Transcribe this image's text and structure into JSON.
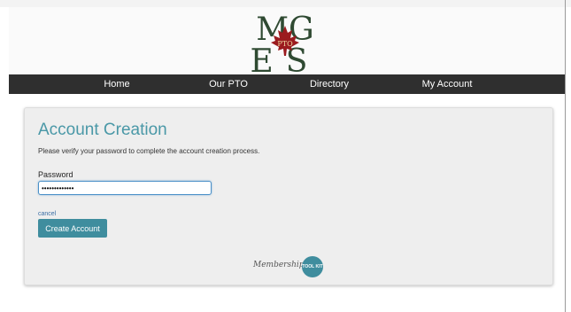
{
  "header": {
    "logo": {
      "top_letters": "MG",
      "bottom_letters": "ES",
      "emblem_text": "PTO",
      "colors": {
        "letters": "#2f4a32",
        "leaf": "#9b1b1f"
      }
    }
  },
  "nav": {
    "items": [
      {
        "label": "Home"
      },
      {
        "label": "Our PTO"
      },
      {
        "label": "Directory"
      },
      {
        "label": "My Account"
      }
    ]
  },
  "form": {
    "title": "Account Creation",
    "description": "Please verify your password to complete the account creation process.",
    "password_label": "Password",
    "password_value": "•••••••••••••",
    "cancel_label": "cancel",
    "submit_label": "Create Account"
  },
  "footer": {
    "brand_script": "Membership",
    "brand_badge": "TOOL KIT"
  },
  "colors": {
    "accent": "#4a98a7",
    "button": "#3f8d9e",
    "nav_bg": "#2f2f2f"
  }
}
